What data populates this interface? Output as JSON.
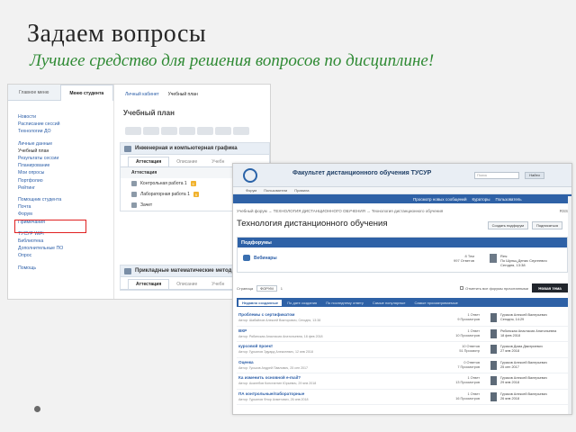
{
  "slide": {
    "title": "Задаем вопросы",
    "subtitle": "Лучшее средство для решения вопросов по дисциплине!"
  },
  "portal": {
    "side_tabs": [
      "Главное меню",
      "Меню студента"
    ],
    "side_items": [
      {
        "label": "Новости"
      },
      {
        "label": "Расписание сессий"
      },
      {
        "label": "Технологии ДО"
      },
      {
        "gap": true
      },
      {
        "label": "Личные данные"
      },
      {
        "label": "Учебный план",
        "current": true
      },
      {
        "label": "Результаты сессии"
      },
      {
        "label": "Планирование"
      },
      {
        "label": "Мои опросы"
      },
      {
        "label": "Портфолио"
      },
      {
        "label": "Рейтинг"
      },
      {
        "gap": true
      },
      {
        "label": "Помощник студента"
      },
      {
        "label": "Почта"
      },
      {
        "label": "Форум"
      },
      {
        "label": "Примечания"
      },
      {
        "gap": true
      },
      {
        "label": "ТУСУР WiFi"
      },
      {
        "label": "Библиотека"
      },
      {
        "label": "Дополнительные ПО"
      },
      {
        "label": "Опрос"
      },
      {
        "gap": true
      },
      {
        "label": "Помощь"
      }
    ],
    "top_tabs": [
      "Личный кабинет",
      "Учебный план"
    ],
    "heading": "Учебный план",
    "steps": [
      "",
      "",
      "",
      "",
      "",
      "",
      ""
    ],
    "cards": [
      {
        "title": "Инженерная и компьютерная графика",
        "tabs": [
          "Аттестация",
          "Описание",
          "Учебн"
        ],
        "section": "Аттестация",
        "rows": [
          {
            "label": "Контрольная работа 1",
            "badge": "5"
          },
          {
            "label": "Лабораторная работа 1",
            "badge": "5"
          },
          {
            "label": "Зачет",
            "badge": ""
          }
        ]
      },
      {
        "title": "Прикладные математические метод",
        "tabs": [
          "Аттестация",
          "Описание",
          "Учебн"
        ]
      }
    ]
  },
  "forum": {
    "site_title": "Факультет дистанционного обучения ТУСУР",
    "search_placeholder": "Поиск",
    "find_label": "Найти",
    "menu": [
      "Форум",
      "Пользователи",
      "Правила"
    ],
    "banner": [
      "Просмотр новых сообщений",
      "Кураторы",
      "Пользователь"
    ],
    "breadcrumb": "Учебный форум  →  ТЕХНОЛОГИЯ ДИСТАНЦИОННОГО ОБУЧЕНИЯ  →  Технология дистанционного обучения",
    "breadcrumb_right": "RSS",
    "page_title": "Технология дистанционного обучения",
    "top_buttons": [
      "Создать подфорум",
      "Подписаться"
    ],
    "subforums_header": "Подфорумы",
    "subforum": {
      "name": "Вебинары",
      "stats": [
        "8 Тем",
        "997 Ответов"
      ],
      "last": [
        "Res:",
        "По Шульц Денис Сергеевич",
        "Сегодня, 13:38"
      ]
    },
    "pages_label": "Страница",
    "page_num": "ФОРУМ",
    "pages_tail": "1",
    "mark_read": "Отметить все форумы прочитанными",
    "new_topic": "Новая тема",
    "filter_tabs": [
      "Недавно созданные",
      "По дате создания",
      "По последнему ответу",
      "Самые популярные",
      "Самые просматриваемые"
    ],
    "topics": [
      {
        "title": "Проблемы с сертификатом",
        "meta": "Автор: Шабайлов Алексей Викторович, Сегодня, 13:38",
        "stats": [
          "1 Ответ",
          "9 Просмотров"
        ],
        "last": [
          "Гуриков Алексей Валерьевич",
          "Сегодня, 14:29"
        ]
      },
      {
        "title": "ВКР",
        "meta": "Автор: Рябинская Анастасия Анатольевна, 18 фев 2018",
        "stats": [
          "1 Ответ",
          "10 Просмотров"
        ],
        "last": [
          "Рябинская Анастасия Анатольевна",
          "18 фев 2018"
        ]
      },
      {
        "title": "курсовой проект",
        "meta": "Автор: Гурьянов Эдуард Алексеевич, 12 янв 2018",
        "stats": [
          "10 Ответов",
          "51 Просмотр"
        ],
        "last": [
          "Гуриков Дима Дмитриевич",
          "27 янв 2018"
        ]
      },
      {
        "title": "Оценка",
        "meta": "Автор: Гуськов Андрей Павлович, 25 сен 2017",
        "stats": [
          "0 Ответов",
          "7 Просмотров"
        ],
        "last": [
          "Гуриков Алексей Валерьевич",
          "25 сен 2017"
        ]
      },
      {
        "title": "Ка изменить основной e-mail?",
        "meta": "Автор: Асалебов Константин Юрьевич, 29 янв 2018",
        "stats": [
          "1 Ответ",
          "13 Просмотров"
        ],
        "last": [
          "Гуриков Алексей Валерьевич",
          "29 янв 2018"
        ]
      },
      {
        "title": "ПА контрольные/лабораторные",
        "meta": "Автор: Гурьянов Флор Ахметович, 26 янв 2018",
        "stats": [
          "1 Ответ",
          "16 Просмотров"
        ],
        "last": [
          "Гуриков Алексей Валерьевич",
          "26 янв 2018"
        ]
      }
    ]
  }
}
